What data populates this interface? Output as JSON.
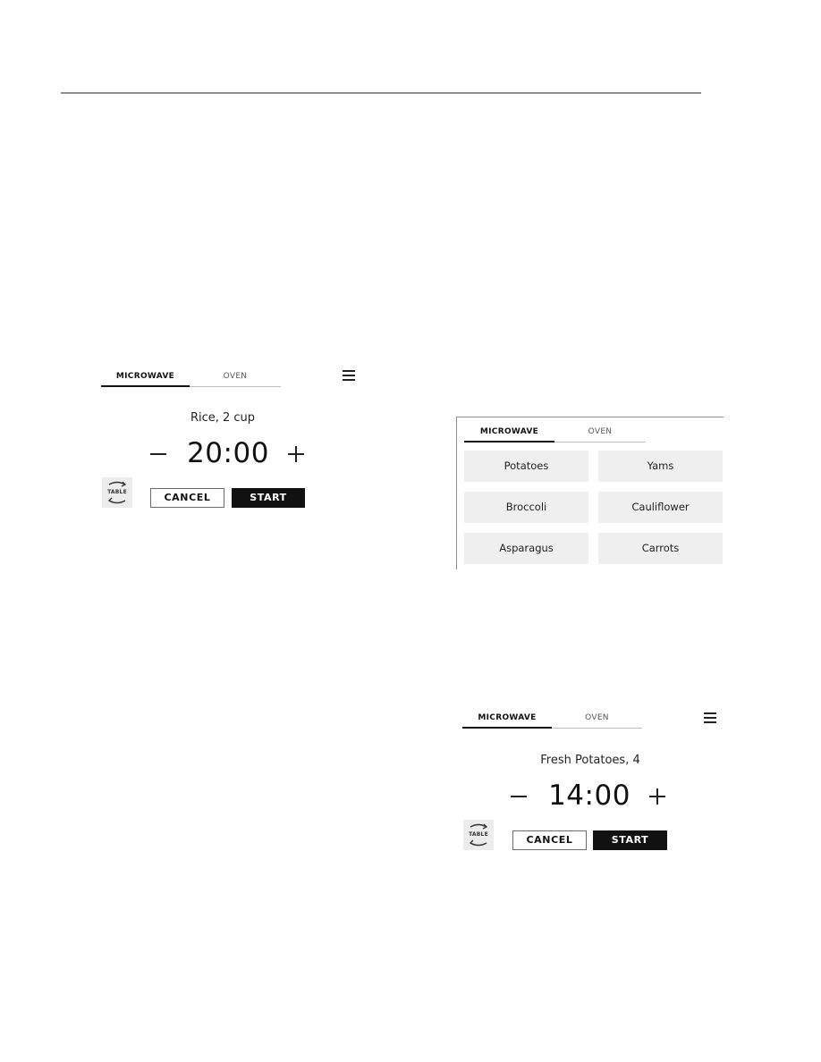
{
  "tabs": {
    "microwave": "MICROWAVE",
    "oven": "OVEN",
    "active": "MICROWAVE"
  },
  "icons": {
    "menu": "hamburger-menu-icon",
    "minus": "minus-icon",
    "plus": "plus-icon",
    "table_toggle": "table-swap-icon"
  },
  "screen_rice": {
    "food": "Rice, 2 cup",
    "time": "20:00",
    "table_label": "TABLE",
    "cancel": "CANCEL",
    "start": "START"
  },
  "food_grid": {
    "items": [
      "Potatoes",
      "Yams",
      "Broccoli",
      "Cauliflower",
      "Asparagus",
      "Carrots"
    ]
  },
  "screen_potatoes": {
    "food": "Fresh Potatoes, 4",
    "time": "14:00",
    "table_label": "TABLE",
    "cancel": "CANCEL",
    "start": "START"
  },
  "colors": {
    "active_tab_underline": "#111111",
    "start_button": "#111111",
    "tile_background": "#efefef",
    "table_button_background": "#ececec"
  }
}
